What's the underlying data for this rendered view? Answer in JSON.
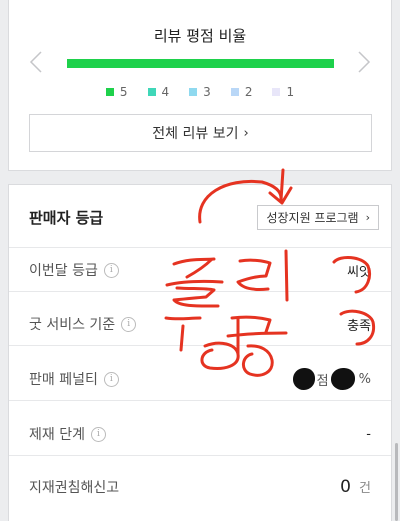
{
  "review": {
    "title": "리뷰 평점 비율",
    "ratio_5": 1.0,
    "legend": [
      {
        "label": "5",
        "color": "#1ed14b"
      },
      {
        "label": "4",
        "color": "#3fd7b8"
      },
      {
        "label": "3",
        "color": "#8fd9ef"
      },
      {
        "label": "2",
        "color": "#b9d7f7"
      },
      {
        "label": "1",
        "color": "#e8e6f9"
      }
    ],
    "all_button": "전체 리뷰 보기",
    "all_button_chevron": "›"
  },
  "grade": {
    "title": "판매자 등급",
    "program_button": "성장지원 프로그램",
    "program_chevron": "›",
    "rows": [
      {
        "label": "이번달 등급",
        "value": "씨앗"
      },
      {
        "label": "굿 서비스 기준",
        "value": "충족"
      },
      {
        "label": "판매 페널티",
        "mid": "점",
        "unit": "%"
      },
      {
        "label": "제재 단계",
        "value": "-"
      },
      {
        "label": "지재권침해신고",
        "value": "0",
        "unit": "건"
      }
    ],
    "info_glyph": "i"
  },
  "colors": {
    "accent_green": "#1ed14b",
    "annotation_red": "#e53321"
  }
}
